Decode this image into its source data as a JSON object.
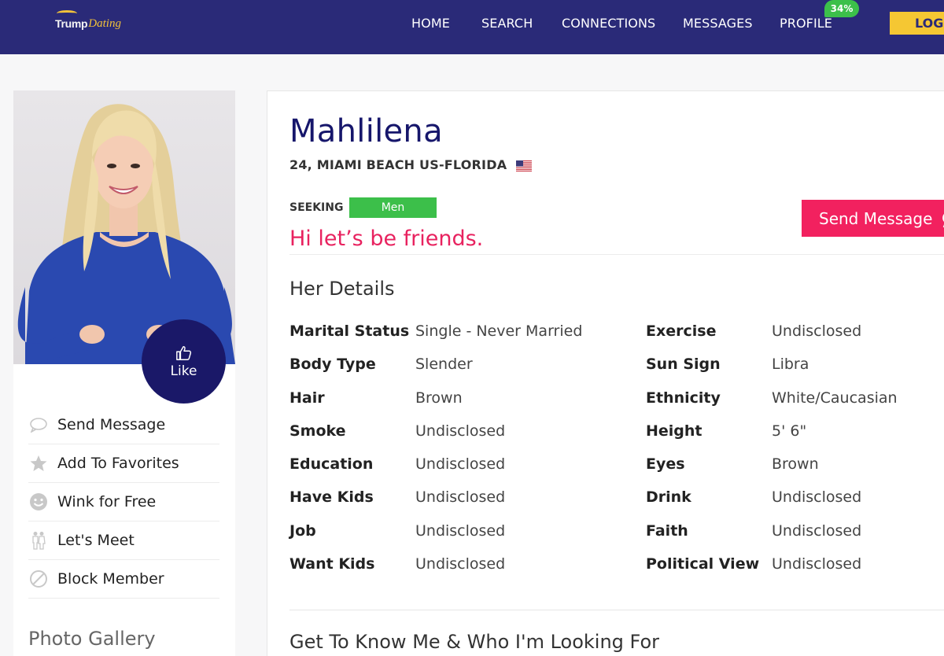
{
  "brand": {
    "logo_trump": "Trump",
    "logo_dating": "Dating",
    "colors": {
      "nav_bg": "#2a2a78",
      "accent_gold": "#f5c733",
      "pink": "#f2215f",
      "green": "#3cbf4a",
      "name_navy": "#16166b"
    }
  },
  "nav": {
    "items": [
      "HOME",
      "SEARCH",
      "CONNECTIONS",
      "MESSAGES",
      "PROFILE"
    ],
    "profile_badge": "34%",
    "logout_label": "LOGOUT"
  },
  "sidebar": {
    "like_label": "Like",
    "actions": [
      {
        "label": "Send Message",
        "icon": "speech-bubble-icon"
      },
      {
        "label": "Add To Favorites",
        "icon": "star-icon"
      },
      {
        "label": "Wink for Free",
        "icon": "smiley-icon"
      },
      {
        "label": "Let's Meet",
        "icon": "couple-icon"
      },
      {
        "label": "Block Member",
        "icon": "block-icon"
      }
    ],
    "photo_gallery_title": "Photo Gallery"
  },
  "profile": {
    "name": "Mahlilena",
    "location": "24, MIAMI BEACH US-FLORIDA",
    "flag_icon": "us-flag-icon",
    "seeking_label": "SEEKING",
    "seeking_value": "Men",
    "tagline": "Hi let’s be friends.",
    "send_message_label": "Send Message"
  },
  "details": {
    "title": "Her Details",
    "left": [
      {
        "label": "Marital Status",
        "value": "Single - Never Married"
      },
      {
        "label": "Body Type",
        "value": "Slender"
      },
      {
        "label": "Hair",
        "value": "Brown"
      },
      {
        "label": "Smoke",
        "value": "Undisclosed"
      },
      {
        "label": "Education",
        "value": "Undisclosed"
      },
      {
        "label": "Have Kids",
        "value": "Undisclosed"
      },
      {
        "label": "Job",
        "value": "Undisclosed"
      },
      {
        "label": "Want Kids",
        "value": "Undisclosed"
      }
    ],
    "right": [
      {
        "label": "Exercise",
        "value": "Undisclosed"
      },
      {
        "label": "Sun Sign",
        "value": "Libra"
      },
      {
        "label": "Ethnicity",
        "value": "White/Caucasian"
      },
      {
        "label": "Height",
        "value": "5' 6\""
      },
      {
        "label": "Eyes",
        "value": "Brown"
      },
      {
        "label": "Drink",
        "value": "Undisclosed"
      },
      {
        "label": "Faith",
        "value": "Undisclosed"
      },
      {
        "label": "Political View",
        "value": "Undisclosed"
      }
    ]
  },
  "about": {
    "title": "Get To Know Me & Who I'm Looking For"
  }
}
